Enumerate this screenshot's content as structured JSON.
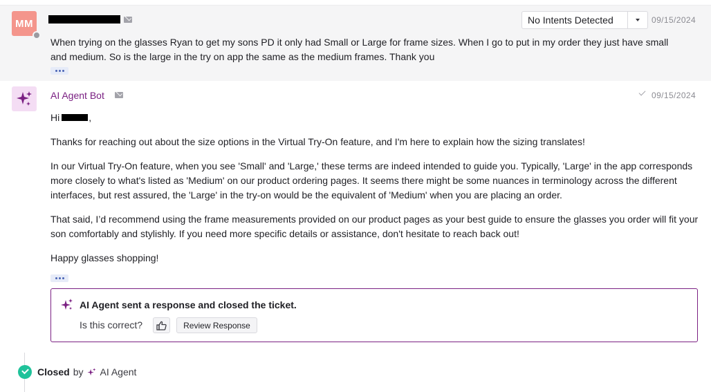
{
  "customer_message": {
    "avatar_initials": "MM",
    "intent_select": {
      "selected": "No Intents Detected"
    },
    "date": "09/15/2024",
    "text": "When trying on the glasses Ryan to get my sons PD it only had Small or Large for frame sizes. When I go to put in my order they just have small and medium. So is the large in the try on app the same as the medium frames. Thank you"
  },
  "bot_message": {
    "sender": "AI Agent Bot",
    "date": "09/15/2024",
    "greeting_prefix": "Hi",
    "greeting_suffix": ",",
    "paragraphs": [
      "Thanks for reaching out about the size options in the Virtual Try-On feature, and I'm here to explain how the sizing translates!",
      "In our Virtual Try-On feature, when you see 'Small' and 'Large,' these terms are indeed intended to guide you. Typically, 'Large' in the app corresponds more closely to what's listed as 'Medium' on our product ordering pages. It seems there might be some nuances in terminology across the different interfaces, but rest assured, the 'Large' in the try-on would be the equivalent of 'Medium' when you are placing an order.",
      "That said, I’d recommend using the frame measurements provided on our product pages as your best guide to ensure the glasses you order will fit your son comfortably and stylishly. If you need more specific details or assistance, don't hesitate to reach back out!",
      "Happy glasses shopping!"
    ]
  },
  "closed_card": {
    "title": "AI Agent sent a response and closed the ticket.",
    "question": "Is this correct?",
    "review_button": "Review Response"
  },
  "timeline": {
    "status": "Closed",
    "by": "by",
    "actor": "AI Agent"
  },
  "colors": {
    "brand_purple": "#7a1f82",
    "avatar_salmon": "#f4958c",
    "closed_green": "#1fc29a"
  },
  "icons": [
    "mail-icon",
    "sparkle-icon",
    "check-icon",
    "thumbs-up-icon",
    "chevron-down-icon",
    "checkmark-circle-icon"
  ]
}
